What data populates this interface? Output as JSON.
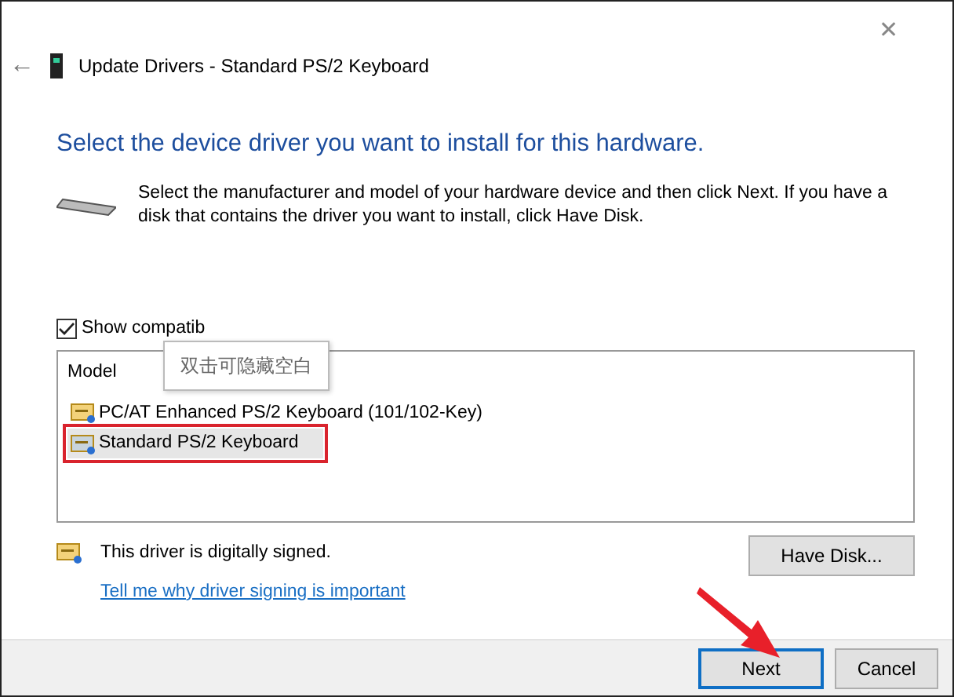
{
  "window": {
    "title": "Update Drivers - Standard PS/2 Keyboard",
    "close": "✕",
    "back": "←"
  },
  "heading": "Select the device driver you want to install for this hardware.",
  "description": "Select the manufacturer and model of your hardware device and then click Next. If you have a disk that contains the driver you want to install, click Have Disk.",
  "show_compatible": {
    "label": "Show compatib",
    "checked": true
  },
  "tooltip": "双击可隐藏空白",
  "model_list": {
    "header": "Model",
    "items": [
      {
        "label": "PC/AT Enhanced PS/2 Keyboard (101/102-Key)",
        "selected": false,
        "highlighted": false
      },
      {
        "label": "Standard PS/2 Keyboard",
        "selected": true,
        "highlighted": true
      }
    ]
  },
  "signed_text": "This driver is digitally signed.",
  "signing_link": "Tell me why driver signing is important",
  "have_disk_button": "Have Disk...",
  "footer_buttons": [
    {
      "label": "Next",
      "default": true,
      "pointed": true
    },
    {
      "label": "Cancel",
      "default": false,
      "pointed": false
    }
  ]
}
